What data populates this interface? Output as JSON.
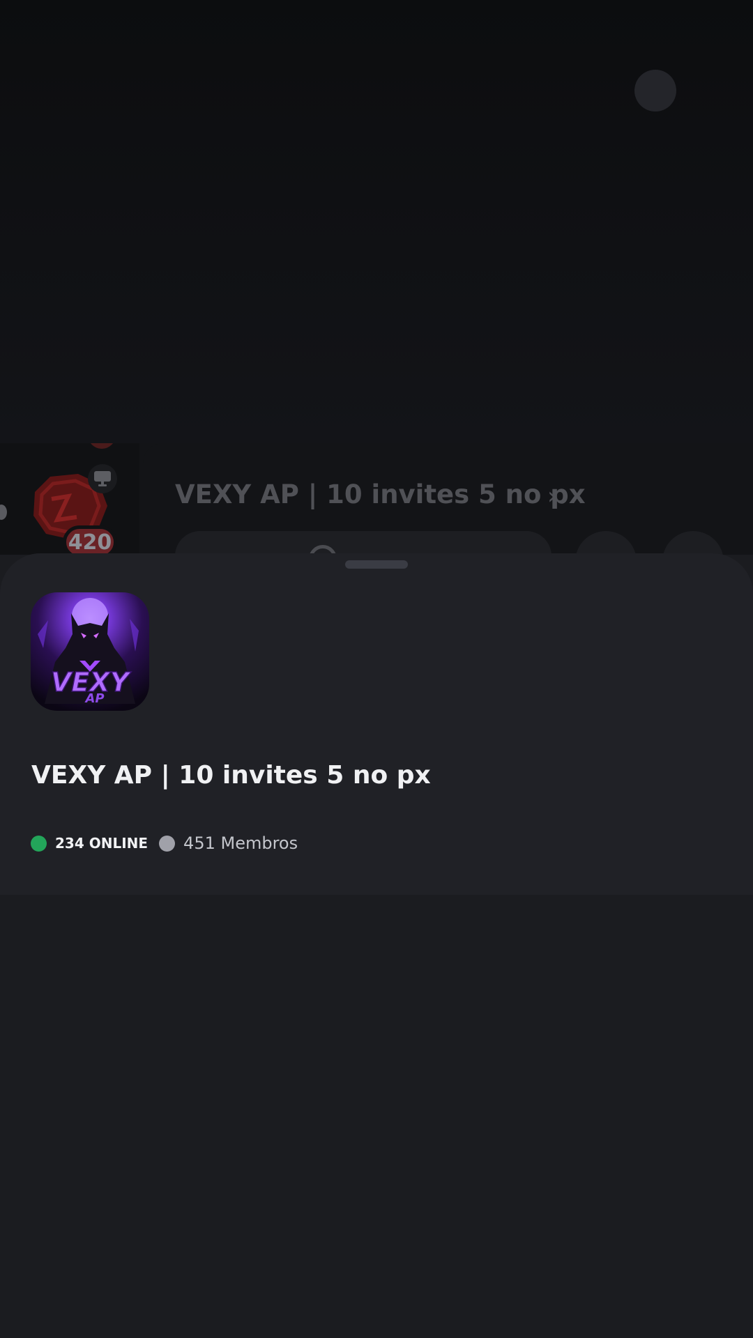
{
  "background": {
    "server_title": "VEXY AP | 10 invites 5 no px",
    "mention_count": "420"
  },
  "sheet": {
    "server_avatar_text": "VEXY",
    "server_avatar_subtext": "AP",
    "server_name": "VEXY AP | 10 invites 5 no px",
    "online_count": "234 ONLINE",
    "member_count": "451 Membros"
  },
  "colors": {
    "online": "#23a55a",
    "members": "#a0a1a9",
    "avatar_accent": "#9b4dff"
  },
  "icons": {
    "guild": "guild-logo-icon",
    "screen": "monitor-icon",
    "chevron": "chevron-right-icon",
    "search": "search-icon",
    "online": "online-status-dot",
    "members": "members-status-dot"
  }
}
